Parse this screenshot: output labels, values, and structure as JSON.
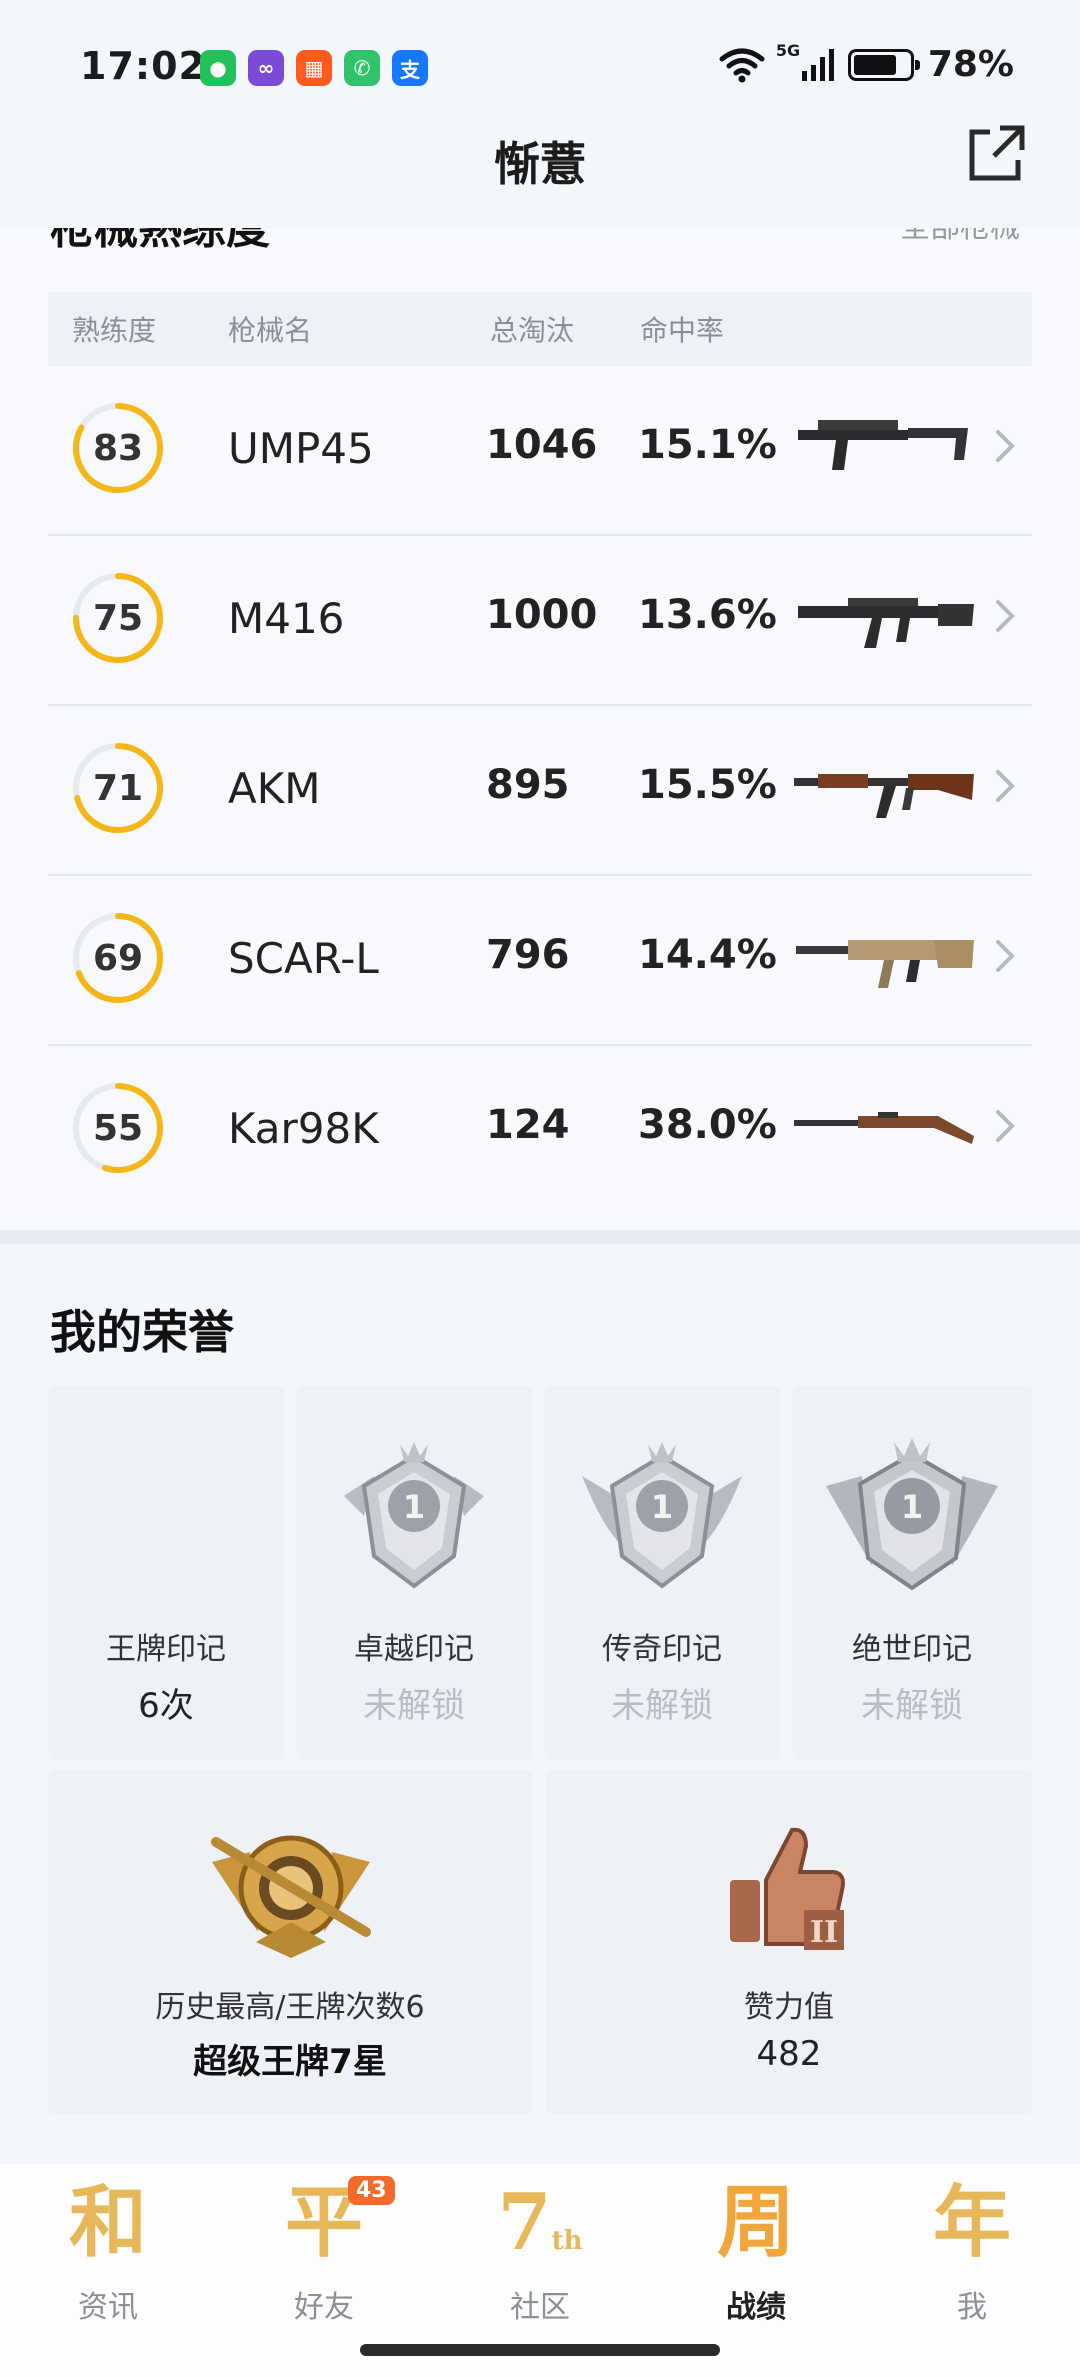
{
  "status_bar": {
    "time": "17:02",
    "apps": [
      {
        "icon": "wechat-icon",
        "color": "#21c25a",
        "glyph": "💬"
      },
      {
        "icon": "soul-icon",
        "color": "#7b4bd8",
        "glyph": "∞"
      },
      {
        "icon": "grid-app-icon",
        "color": "#ff5a1f",
        "glyph": "品"
      },
      {
        "icon": "phone-icon",
        "color": "#31c36b",
        "glyph": "✆"
      },
      {
        "icon": "alipay-icon",
        "color": "#1677ff",
        "glyph": "支"
      }
    ],
    "network": "5G",
    "battery": "78%",
    "battery_level": 0.78
  },
  "header": {
    "title": "惭薏"
  },
  "weapon_section": {
    "title": "枪械熟练度",
    "link": "全部枪械",
    "columns": [
      "熟练度",
      "枪械名",
      "总淘汰",
      "命中率"
    ],
    "rows": [
      {
        "proficiency": "83",
        "progress": 0.83,
        "name": "UMP45",
        "kills": "1046",
        "rate": "15.1%",
        "gun": "smg"
      },
      {
        "proficiency": "75",
        "progress": 0.75,
        "name": "M416",
        "kills": "1000",
        "rate": "13.6%",
        "gun": "rifle-black"
      },
      {
        "proficiency": "71",
        "progress": 0.71,
        "name": "AKM",
        "kills": "895",
        "rate": "15.5%",
        "gun": "rifle-wood"
      },
      {
        "proficiency": "69",
        "progress": 0.69,
        "name": "SCAR-L",
        "kills": "796",
        "rate": "14.4%",
        "gun": "rifle-tan"
      },
      {
        "proficiency": "55",
        "progress": 0.55,
        "name": "Kar98K",
        "kills": "124",
        "rate": "38.0%",
        "gun": "sniper"
      }
    ],
    "ring_color": "#f5b617"
  },
  "honor_section": {
    "title": "我的荣誉",
    "marks": [
      {
        "label": "王牌印记",
        "value": "6次",
        "locked": false,
        "badge": ""
      },
      {
        "label": "卓越印记",
        "value": "未解锁",
        "locked": true,
        "badge": "1"
      },
      {
        "label": "传奇印记",
        "value": "未解锁",
        "locked": true,
        "badge": "1"
      },
      {
        "label": "绝世印记",
        "value": "未解锁",
        "locked": true,
        "badge": "1"
      }
    ],
    "highest": {
      "label": "历史最高/王牌次数6",
      "value": "超级王牌7星"
    },
    "praise": {
      "label": "赞力值",
      "value": "482"
    }
  },
  "tab_bar": {
    "tabs": [
      {
        "glyph": "和",
        "label": "资讯",
        "active": false
      },
      {
        "glyph": "平",
        "label": "好友",
        "active": false,
        "badge": "43"
      },
      {
        "glyph": "7",
        "sup": "th",
        "label": "社区",
        "active": false
      },
      {
        "glyph": "周",
        "label": "战绩",
        "active": true
      },
      {
        "glyph": "年",
        "label": "我",
        "active": false
      }
    ]
  }
}
